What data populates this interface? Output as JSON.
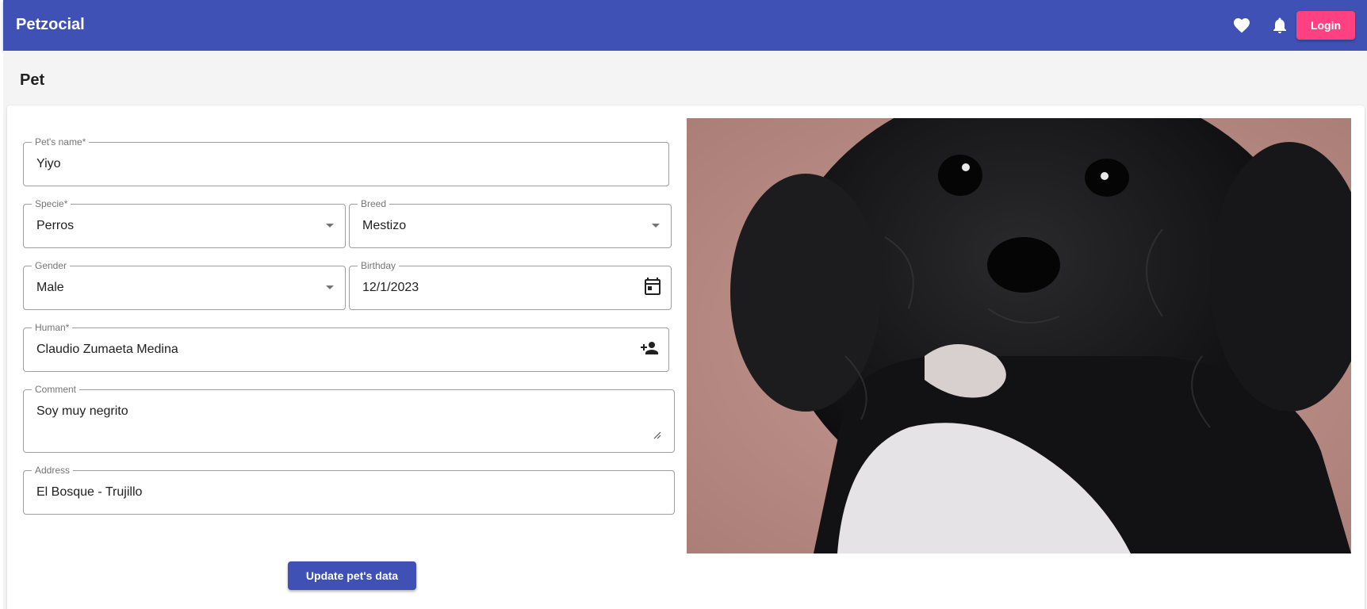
{
  "app": {
    "brand": "Petzocial",
    "login_label": "Login",
    "icons": [
      "favorite-icon",
      "notifications-icon"
    ],
    "colors": {
      "primary": "#3f51b5",
      "accent": "#ff4081"
    }
  },
  "page": {
    "title": "Pet"
  },
  "form": {
    "pet_name": {
      "label": "Pet's name*",
      "value": "Yiyo"
    },
    "specie": {
      "label": "Specie*",
      "value": "Perros"
    },
    "breed": {
      "label": "Breed",
      "value": "Mestizo"
    },
    "gender": {
      "label": "Gender",
      "value": "Male"
    },
    "birthday": {
      "label": "Birthday",
      "value": "12/1/2023"
    },
    "human": {
      "label": "Human*",
      "value": "Claudio Zumaeta Medina"
    },
    "comment": {
      "label": "Comment",
      "value": "Soy muy negrito"
    },
    "address": {
      "label": "Address",
      "value": "El Bosque - Trujillo"
    },
    "submit_label": "Update pet's data"
  }
}
